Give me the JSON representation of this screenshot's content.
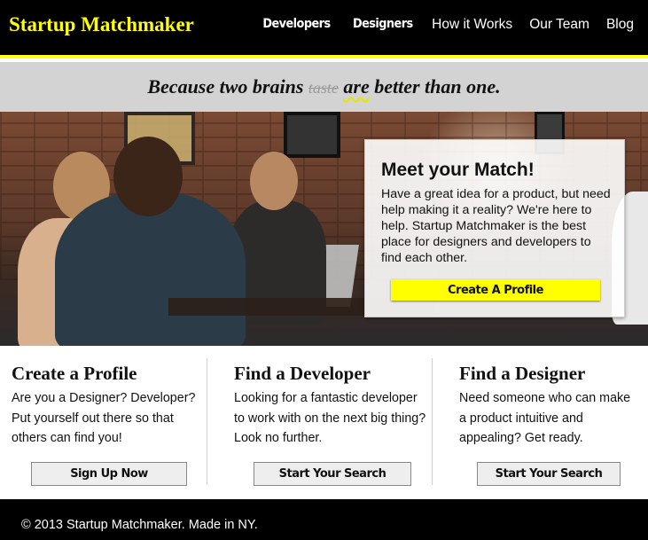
{
  "header": {
    "logo": "Startup Matchmaker",
    "nav": [
      {
        "label": "Developers"
      },
      {
        "label": "Designers"
      },
      {
        "label": "How it Works"
      },
      {
        "label": "Our Team"
      },
      {
        "label": "Blog"
      }
    ],
    "accent_color": "#ffff00"
  },
  "tagline": {
    "part1": "Because two brains ",
    "struck": "taste",
    "part2": " ",
    "underlined": "are",
    "part3": " better than one."
  },
  "hero": {
    "card_title": "Meet your Match!",
    "card_text": "Have a great idea for a product, but need help making it a reality? We're here to help. Startup Matchmaker is the best place for designers and developers to find each other.",
    "cta_label": "Create A Profile"
  },
  "features": [
    {
      "title": "Create a Profile",
      "text": "Are you a Designer? Developer? Put yourself out there so that others can find you!",
      "button": "Sign Up Now"
    },
    {
      "title": "Find a Developer",
      "text": "Looking for a fantastic developer to work with on the next big thing? Look no further.",
      "button": "Start Your Search"
    },
    {
      "title": "Find a Designer",
      "text": "Need someone who can make a product intuitive and appealing? Get ready.",
      "button": "Start Your Search"
    }
  ],
  "footer": {
    "text": "© 2013 Startup Matchmaker. Made in NY."
  }
}
